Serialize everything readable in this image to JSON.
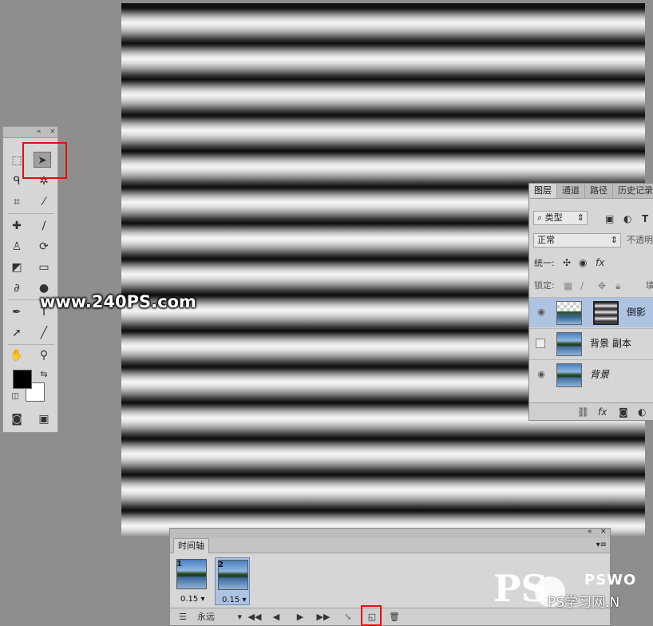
{
  "watermark": {
    "text": "www.240PS.com"
  },
  "layers_panel": {
    "tabs": [
      "图层",
      "通道",
      "路径",
      "历史记录"
    ],
    "filter_label": "类型",
    "blend_mode": "正常",
    "opacity_label": "不透明",
    "unify_label": "统一:",
    "lock_label": "锁定:",
    "fill_label": "填",
    "layers": [
      {
        "name": "倒影",
        "visible": true,
        "selected": true
      },
      {
        "name": "背景 副本",
        "visible": false,
        "selected": false
      },
      {
        "name": "背景",
        "visible": true,
        "selected": false
      }
    ]
  },
  "timeline": {
    "tab_label": "时间轴",
    "frames": [
      {
        "number": "1",
        "delay": "0.15"
      },
      {
        "number": "2",
        "delay": "0.15"
      }
    ],
    "loop_option": "永远"
  },
  "logo": {
    "ps_text": "PS",
    "pswo_text": "PSWO",
    "cn_text": "PS学习网.N"
  },
  "colors": {
    "accent_red": "#e01010",
    "selection_blue": "#aec3e2"
  }
}
